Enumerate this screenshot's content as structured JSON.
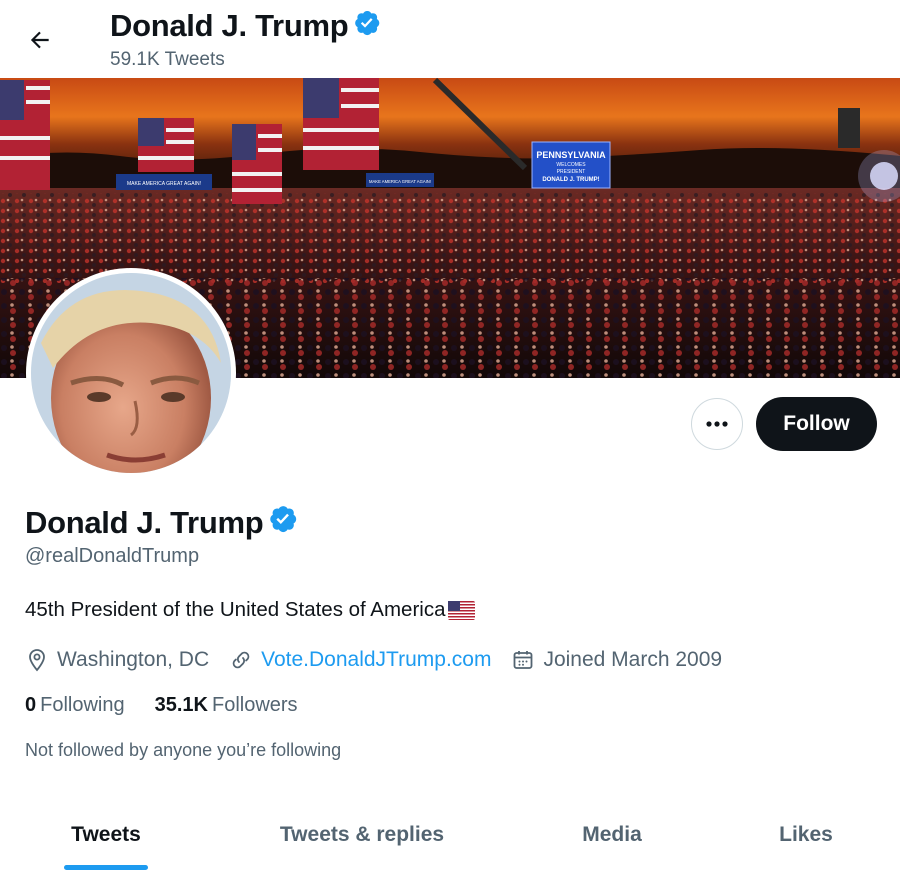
{
  "header": {
    "title": "Donald J. Trump",
    "tweet_count": "59.1K Tweets",
    "back_icon": "arrow-left-icon",
    "verified_icon": "verified-badge-icon"
  },
  "banner": {
    "sign_left": "MAKE AMERICA GREAT AGAIN!",
    "sign_mid": "MAKE AMERICA GREAT AGAIN!",
    "screen_line1": "PENNSYLVANIA",
    "screen_line2": "WELCOMES",
    "screen_line3": "PRESIDENT",
    "screen_line4": "DONALD J. TRUMP!"
  },
  "profile": {
    "name": "Donald J. Trump",
    "handle": "@realDonaldTrump",
    "bio": "45th President of the United States of America",
    "location": "Washington, DC",
    "website": "Vote.DonaldJTrump.com",
    "joined": "Joined March 2009",
    "following_count": "0",
    "following_label": "Following",
    "followers_count": "35.1K",
    "followers_label": "Followers",
    "not_followed": "Not followed by anyone you’re following"
  },
  "actions": {
    "more_icon": "ellipsis-icon",
    "follow_label": "Follow"
  },
  "tabs": [
    {
      "label": "Tweets",
      "active": true
    },
    {
      "label": "Tweets & replies",
      "active": false
    },
    {
      "label": "Media",
      "active": false
    },
    {
      "label": "Likes",
      "active": false
    }
  ],
  "colors": {
    "accent": "#1d9bf0",
    "text": "#0f1419",
    "secondary": "#536471",
    "button_dark": "#0f1419"
  }
}
